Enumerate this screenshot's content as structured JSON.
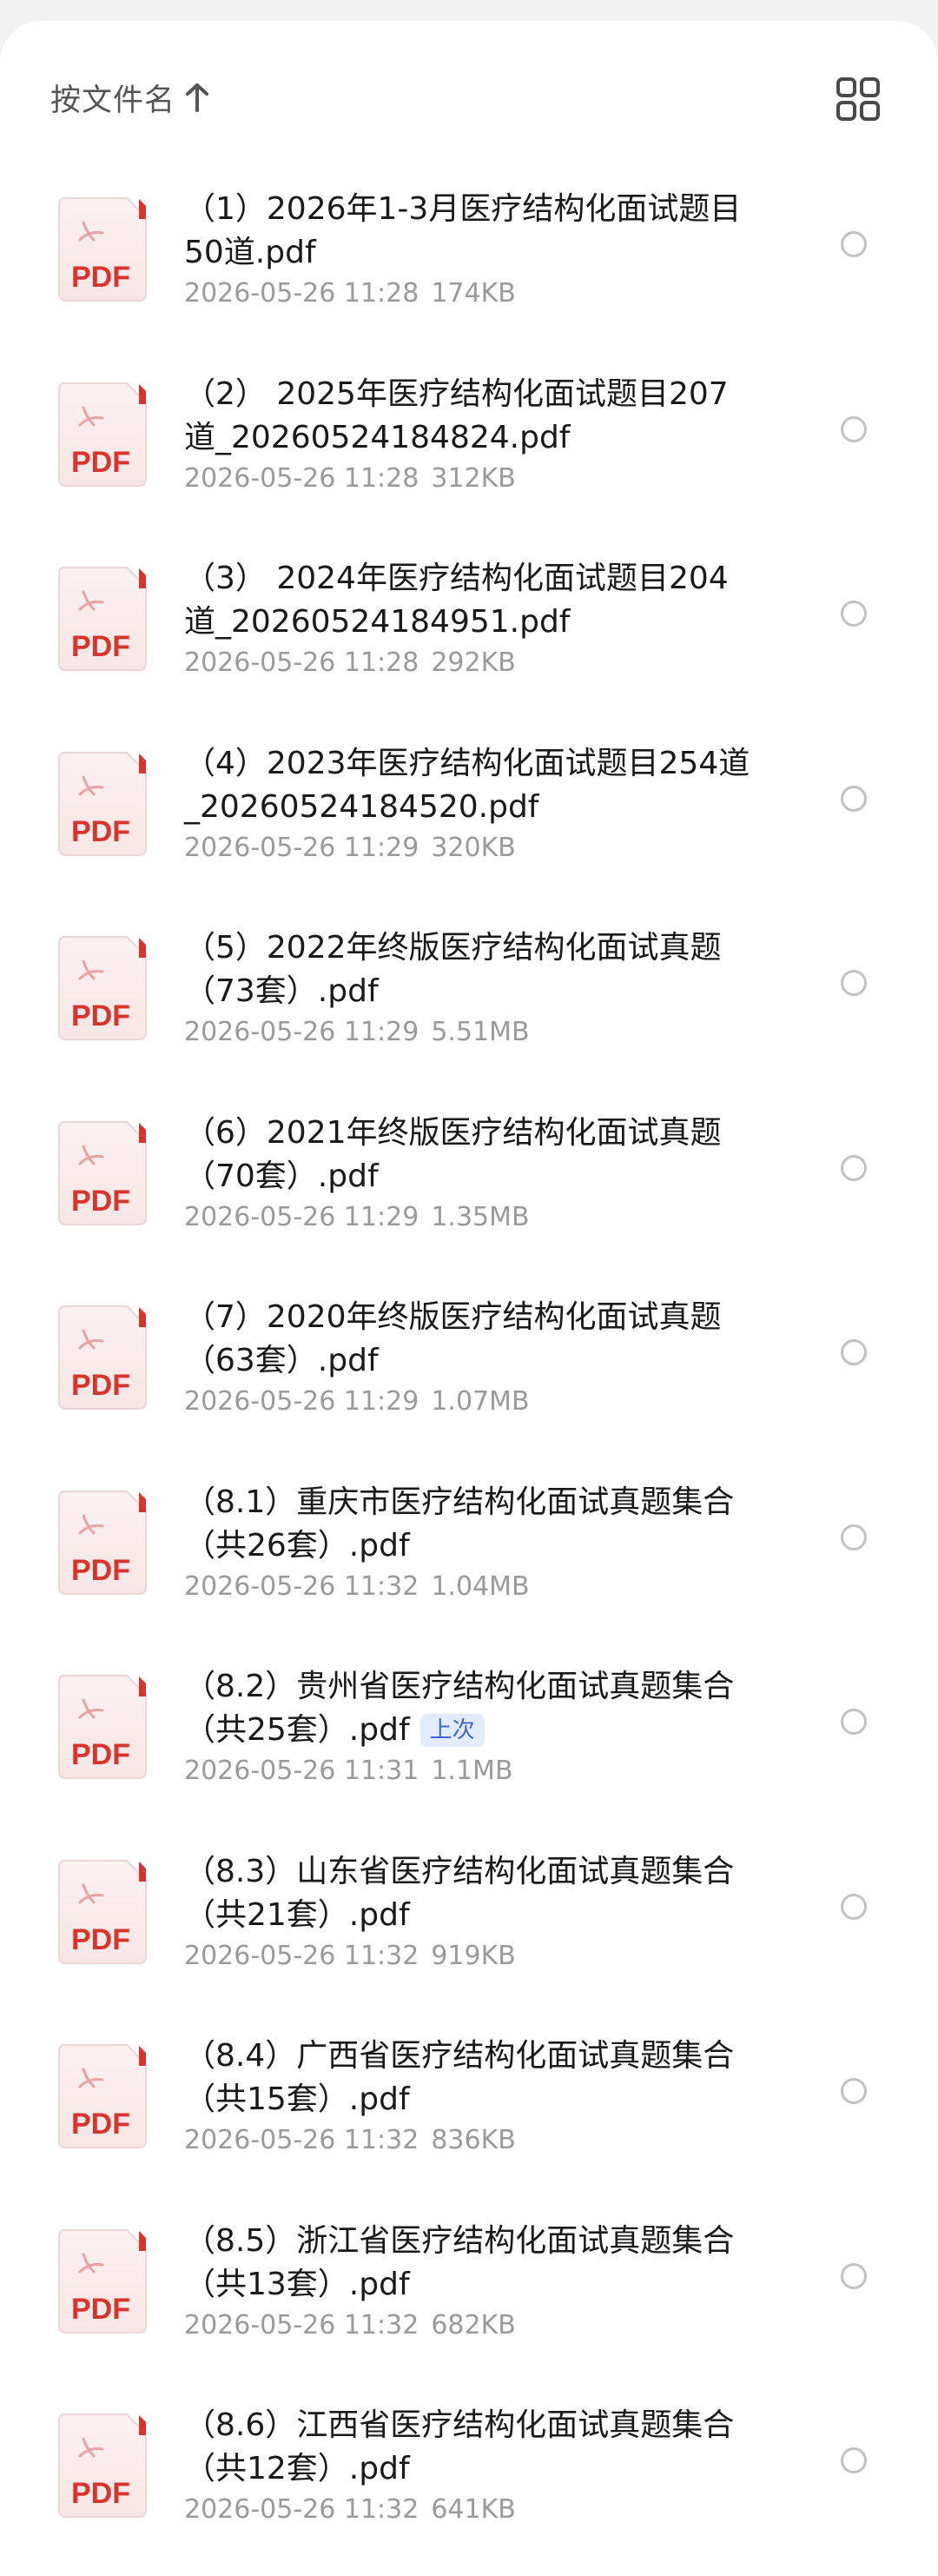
{
  "header": {
    "sort_label": "按文件名",
    "sort_direction_icon": "arrow-up-icon",
    "view_toggle_icon": "grid-view-icon"
  },
  "file_type_label": "PDF",
  "colors": {
    "pdf_red": "#d9342b",
    "badge_bg": "#e3ebff",
    "badge_text": "#3a66d6"
  },
  "files": [
    {
      "name": "（1）2026年1-3月医疗结构化面试题目50道.pdf",
      "date": "2026-05-26 11:28",
      "size": "174KB",
      "badge": ""
    },
    {
      "name": "（2） 2025年医疗结构化面试题目207道_20260524184824.pdf",
      "date": "2026-05-26 11:28",
      "size": "312KB",
      "badge": ""
    },
    {
      "name": "（3） 2024年医疗结构化面试题目204道_20260524184951.pdf",
      "date": "2026-05-26 11:28",
      "size": "292KB",
      "badge": ""
    },
    {
      "name": "（4）2023年医疗结构化面试题目254道_20260524184520.pdf",
      "date": "2026-05-26 11:29",
      "size": "320KB",
      "badge": ""
    },
    {
      "name": "（5）2022年终版医疗结构化面试真题（73套）.pdf",
      "date": "2026-05-26 11:29",
      "size": "5.51MB",
      "badge": ""
    },
    {
      "name": "（6）2021年终版医疗结构化面试真题（70套）.pdf",
      "date": "2026-05-26 11:29",
      "size": "1.35MB",
      "badge": ""
    },
    {
      "name": "（7）2020年终版医疗结构化面试真题（63套）.pdf",
      "date": "2026-05-26 11:29",
      "size": "1.07MB",
      "badge": ""
    },
    {
      "name": "（8.1）重庆市医疗结构化面试真题集合（共26套）.pdf",
      "date": "2026-05-26 11:32",
      "size": "1.04MB",
      "badge": ""
    },
    {
      "name": "（8.2）贵州省医疗结构化面试真题集合（共25套）.pdf",
      "date": "2026-05-26 11:31",
      "size": "1.1MB",
      "badge": "上次"
    },
    {
      "name": "（8.3）山东省医疗结构化面试真题集合（共21套）.pdf",
      "date": "2026-05-26 11:32",
      "size": "919KB",
      "badge": ""
    },
    {
      "name": "（8.4）广西省医疗结构化面试真题集合（共15套）.pdf",
      "date": "2026-05-26 11:32",
      "size": "836KB",
      "badge": ""
    },
    {
      "name": "（8.5）浙江省医疗结构化面试真题集合（共13套）.pdf",
      "date": "2026-05-26 11:32",
      "size": "682KB",
      "badge": ""
    },
    {
      "name": "（8.6）江西省医疗结构化面试真题集合（共12套）.pdf",
      "date": "2026-05-26 11:32",
      "size": "641KB",
      "badge": ""
    }
  ]
}
